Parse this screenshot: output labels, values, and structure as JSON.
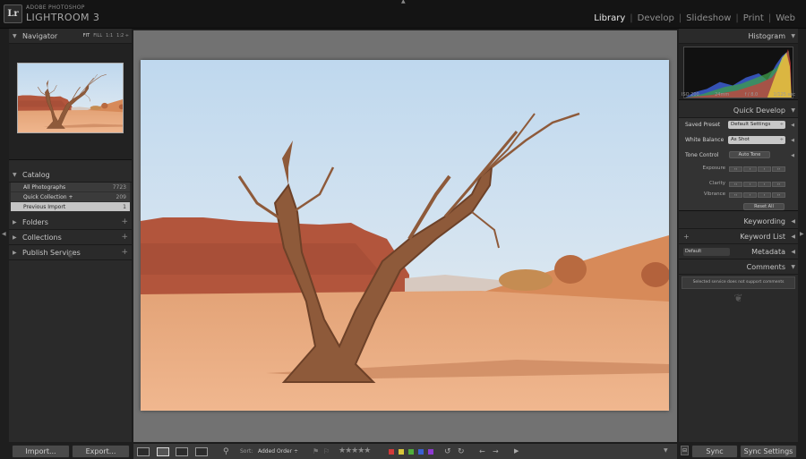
{
  "app": {
    "logo": "Lr",
    "brand_small": "ADOBE PHOTOSHOP",
    "brand_big": "LIGHTROOM 3"
  },
  "modules": [
    {
      "label": "Library",
      "active": true
    },
    {
      "label": "Develop",
      "active": false
    },
    {
      "label": "Slideshow",
      "active": false
    },
    {
      "label": "Print",
      "active": false
    },
    {
      "label": "Web",
      "active": false
    }
  ],
  "left": {
    "navigator": {
      "title": "Navigator",
      "zoom_fit": "FIT",
      "zoom_fill": "FILL",
      "zoom_1_1": "1:1",
      "zoom_1_2": "1:2 ÷"
    },
    "catalog": {
      "title": "Catalog",
      "items": [
        {
          "label": "All Photographs",
          "count": "7723"
        },
        {
          "label": "Quick Collection +",
          "count": "209"
        },
        {
          "label": "Previous Import",
          "count": "1"
        }
      ]
    },
    "folders": "Folders",
    "collections": "Collections",
    "publish": "Publish Services",
    "import_label": "Import...",
    "export_label": "Export..."
  },
  "right": {
    "histogram": {
      "title": "Histogram",
      "iso": "ISO 200",
      "focal": "24mm",
      "aperture": "f / 8.0",
      "shutter": "1/125 sec"
    },
    "quick_develop": {
      "title": "Quick Develop",
      "saved_preset_label": "Saved Preset",
      "saved_preset_value": "Default Settings",
      "white_balance_label": "White Balance",
      "white_balance_value": "As Shot",
      "tone_control_label": "Tone Control",
      "auto_tone": "Auto Tone",
      "exposure": "Exposure",
      "clarity": "Clarity",
      "vibrance": "Vibrance",
      "reset_all": "Reset All"
    },
    "keywording": "Keywording",
    "keyword_list": "Keyword List",
    "metadata": "Metadata",
    "metadata_preset": "Default",
    "comments": "Comments",
    "comments_msg": "Selected service does not support comments",
    "sync_label": "Sync",
    "sync_settings_label": "Sync Settings"
  },
  "toolbar": {
    "sort_label": "Sort:",
    "sort_value": "Added Order ÷",
    "stars": "★★★★★",
    "color_labels": [
      "#d23a3a",
      "#d8c63a",
      "#4fae3c",
      "#3a5fd2",
      "#8e3ad2"
    ]
  }
}
